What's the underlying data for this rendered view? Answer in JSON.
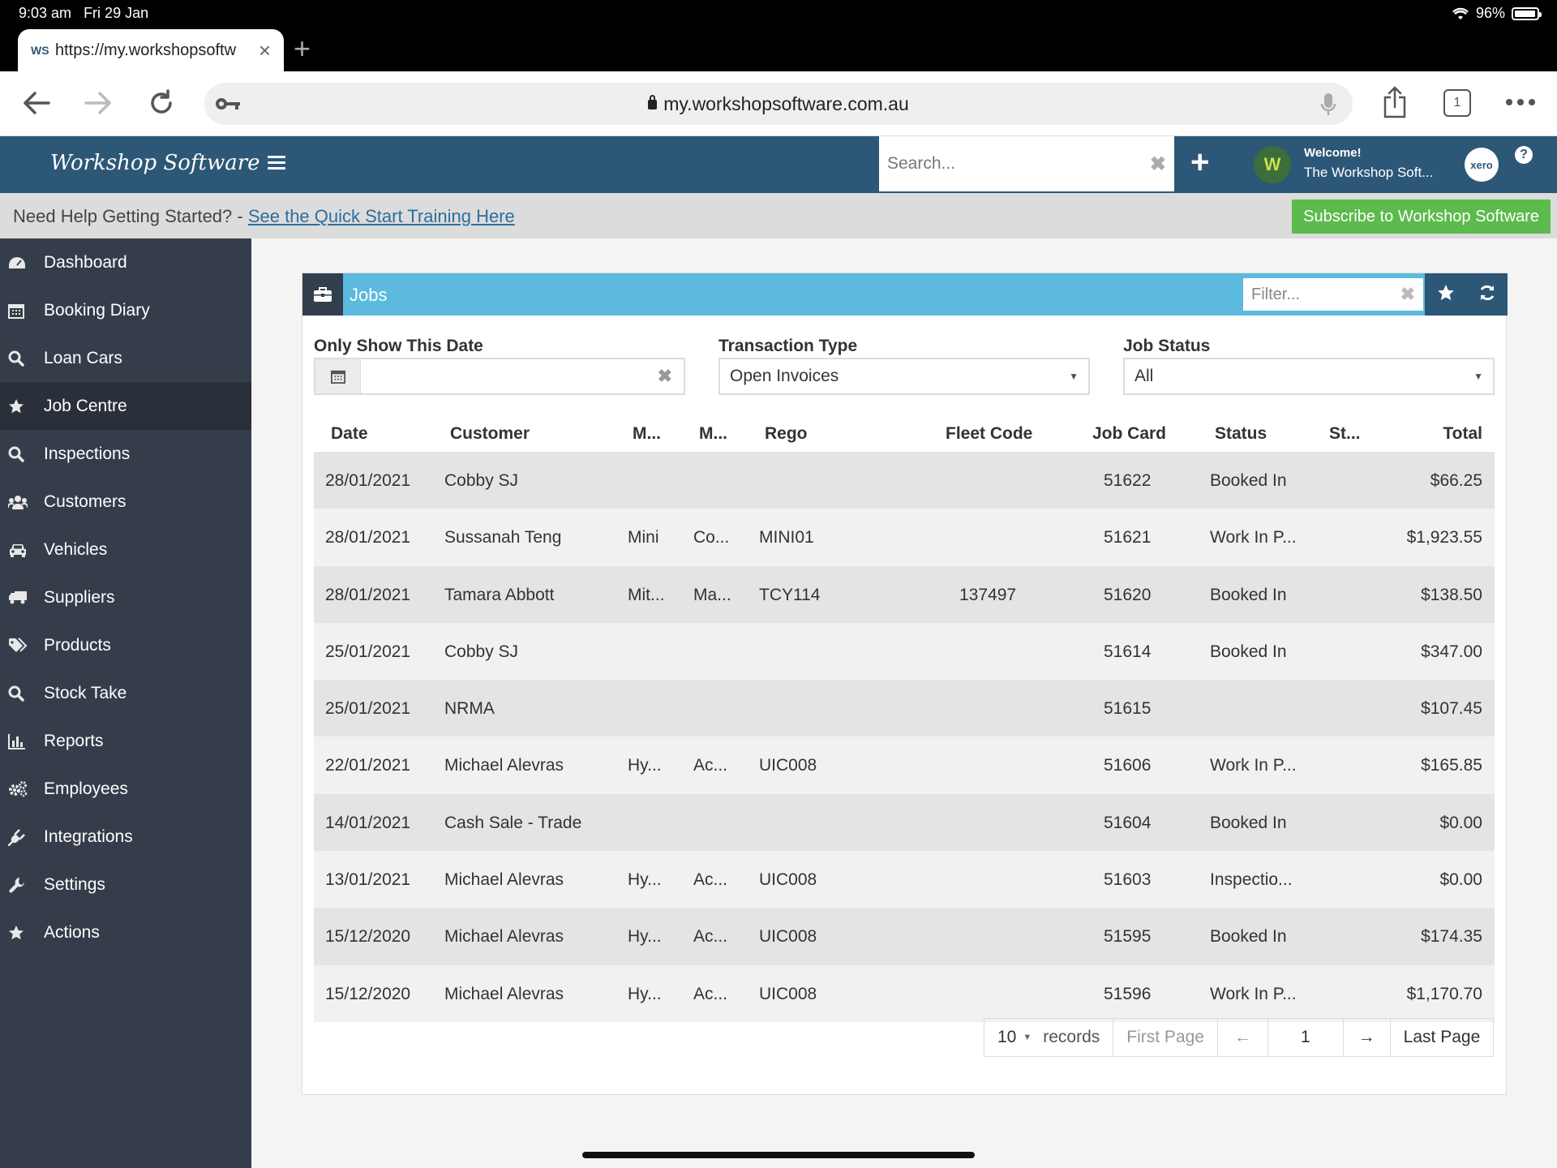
{
  "status_bar": {
    "time": "9:03 am",
    "date": "Fri 29 Jan",
    "battery": "96%"
  },
  "browser": {
    "tab": {
      "favicon": "WS",
      "title": "https://my.workshopsoftw"
    },
    "url": "my.workshopsoftware.com.au",
    "tab_count": "1"
  },
  "app_header": {
    "logo": "Workshop Software",
    "search_placeholder": "Search...",
    "welcome_title": "Welcome!",
    "welcome_name": "The Workshop Soft...",
    "xero_label": "xero",
    "help_label": "?"
  },
  "help_bar": {
    "text": "Need Help Getting Started? - ",
    "link": "See the Quick Start Training Here",
    "subscribe": "Subscribe to Workshop Software"
  },
  "sidebar": {
    "items": [
      {
        "label": "Dashboard",
        "icon": "dashboard-icon"
      },
      {
        "label": "Booking Diary",
        "icon": "calendar-icon"
      },
      {
        "label": "Loan Cars",
        "icon": "search-icon"
      },
      {
        "label": "Job Centre",
        "icon": "star-icon",
        "active": true
      },
      {
        "label": "Inspections",
        "icon": "search-icon"
      },
      {
        "label": "Customers",
        "icon": "users-icon"
      },
      {
        "label": "Vehicles",
        "icon": "car-icon"
      },
      {
        "label": "Suppliers",
        "icon": "truck-icon"
      },
      {
        "label": "Products",
        "icon": "tags-icon"
      },
      {
        "label": "Stock Take",
        "icon": "search-icon"
      },
      {
        "label": "Reports",
        "icon": "bar-chart-icon"
      },
      {
        "label": "Employees",
        "icon": "gears-icon"
      },
      {
        "label": "Integrations",
        "icon": "plug-icon"
      },
      {
        "label": "Settings",
        "icon": "wrench-icon"
      },
      {
        "label": "Actions",
        "icon": "star-icon"
      }
    ]
  },
  "jobs_panel": {
    "title": "Jobs",
    "filter_placeholder": "Filter...",
    "filters": {
      "date_label": "Only Show This Date",
      "date_value": "",
      "transaction_label": "Transaction Type",
      "transaction_value": "Open Invoices",
      "status_label": "Job Status",
      "status_value": "All"
    },
    "columns": [
      "Date",
      "Customer",
      "M...",
      "M...",
      "Rego",
      "Fleet Code",
      "Job Card",
      "Status",
      "St...",
      "Total"
    ],
    "rows": [
      [
        "28/01/2021",
        "Cobby SJ",
        "",
        "",
        "",
        "",
        "51622",
        "Booked In",
        "",
        "$66.25"
      ],
      [
        "28/01/2021",
        "Sussanah Teng",
        "Mini",
        "Co...",
        "MINI01",
        "",
        "51621",
        "Work In P...",
        "",
        "$1,923.55"
      ],
      [
        "28/01/2021",
        "Tamara Abbott",
        "Mit...",
        "Ma...",
        "TCY114",
        "137497",
        "51620",
        "Booked In",
        "",
        "$138.50"
      ],
      [
        "25/01/2021",
        "Cobby SJ",
        "",
        "",
        "",
        "",
        "51614",
        "Booked In",
        "",
        "$347.00"
      ],
      [
        "25/01/2021",
        "NRMA",
        "",
        "",
        "",
        "",
        "51615",
        "",
        "",
        "$107.45"
      ],
      [
        "22/01/2021",
        "Michael Alevras",
        "Hy...",
        "Ac...",
        "UIC008",
        "",
        "51606",
        "Work In P...",
        "",
        "$165.85"
      ],
      [
        "14/01/2021",
        "Cash Sale - Trade",
        "",
        "",
        "",
        "",
        "51604",
        "Booked In",
        "",
        "$0.00"
      ],
      [
        "13/01/2021",
        "Michael Alevras",
        "Hy...",
        "Ac...",
        "UIC008",
        "",
        "51603",
        "Inspectio...",
        "",
        "$0.00"
      ],
      [
        "15/12/2020",
        "Michael Alevras",
        "Hy...",
        "Ac...",
        "UIC008",
        "",
        "51595",
        "Booked In",
        "",
        "$174.35"
      ],
      [
        "15/12/2020",
        "Michael Alevras",
        "Hy...",
        "Ac...",
        "UIC008",
        "",
        "51596",
        "Work In P...",
        "",
        "$1,170.70"
      ]
    ],
    "pager": {
      "page_size": "10",
      "records_label": "records",
      "first": "First Page",
      "prev": "←",
      "page": "1",
      "next": "→",
      "last": "Last Page"
    }
  }
}
